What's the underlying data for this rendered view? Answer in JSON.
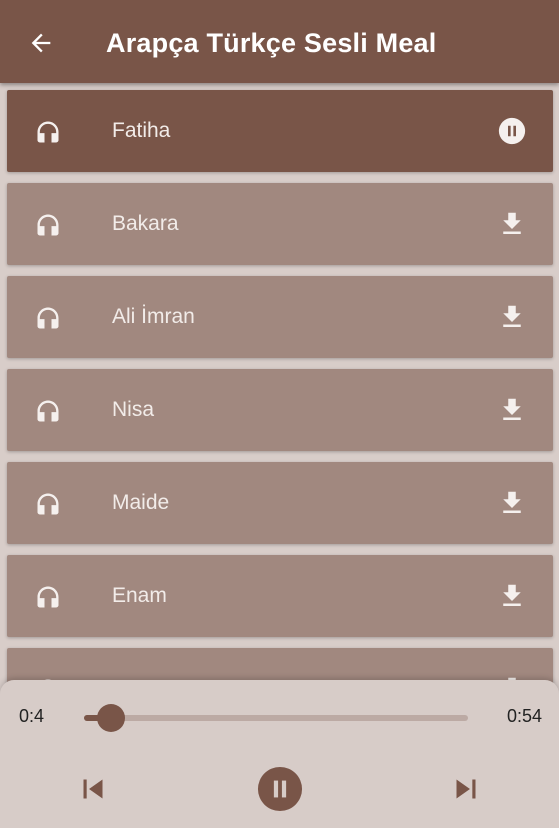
{
  "app_bar": {
    "title": "Arapça Türkçe Sesli Meal",
    "back_icon": "arrow-back-icon"
  },
  "tracks": [
    {
      "name": "Fatiha",
      "state": "playing",
      "action_icon": "pause-circle-icon"
    },
    {
      "name": "Bakara",
      "state": "idle",
      "action_icon": "download-icon"
    },
    {
      "name": "Ali İmran",
      "state": "idle",
      "action_icon": "download-icon"
    },
    {
      "name": "Nisa",
      "state": "idle",
      "action_icon": "download-icon"
    },
    {
      "name": "Maide",
      "state": "idle",
      "action_icon": "download-icon"
    },
    {
      "name": "Enam",
      "state": "idle",
      "action_icon": "download-icon"
    },
    {
      "name": "",
      "state": "idle",
      "action_icon": "download-icon"
    }
  ],
  "player": {
    "current_time": "0:4",
    "duration": "0:54",
    "progress": 0.07,
    "controls": [
      "skip-previous-icon",
      "pause-circle-icon",
      "skip-next-icon"
    ]
  },
  "colors": {
    "primary": "#795548",
    "item_bg": "#a1887f",
    "background": "#d8cdc9",
    "player_bg": "#d7ccc8",
    "track": "#bcaaa4"
  }
}
